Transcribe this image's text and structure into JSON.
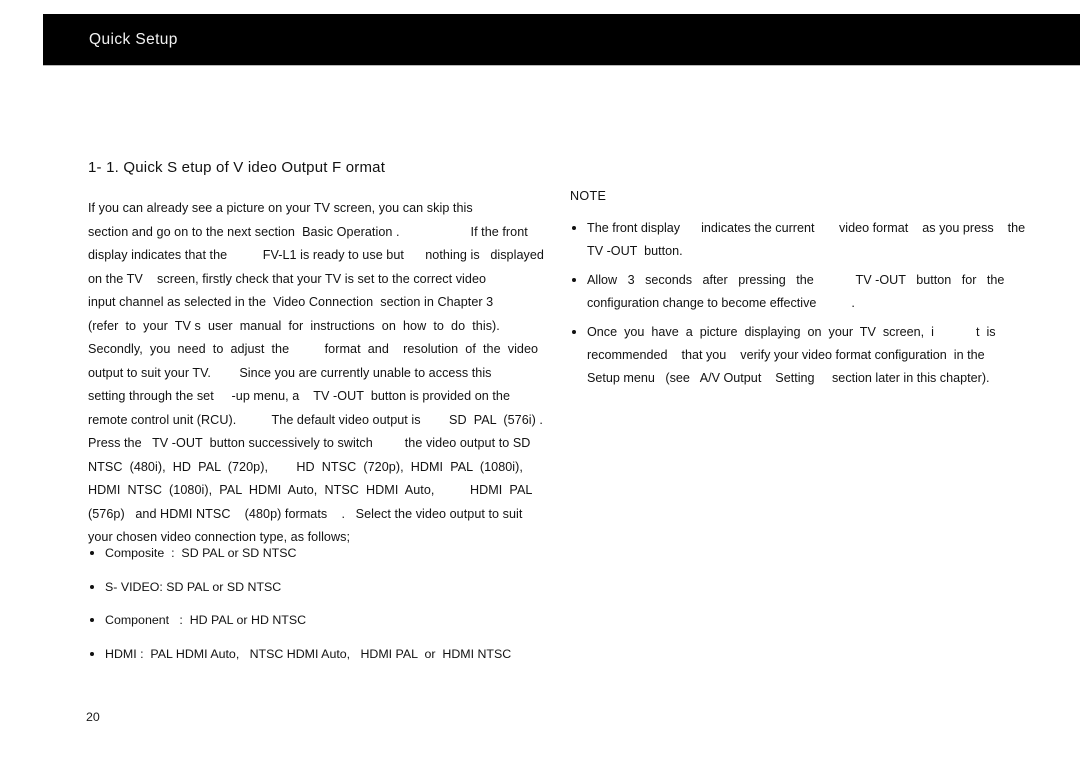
{
  "header": {
    "title": "Quick Setup"
  },
  "section": {
    "heading": "1- 1.  Quick S  etup of    V ideo  Output F    ormat"
  },
  "left_column": {
    "paragraph_lines": [
      "If you can already see a picture on your TV screen, you can skip this",
      "section and go on to the next section  Basic Operation .                    If the front",
      "display indicates that the          FV-L1 is ready to use but      nothing is   displayed",
      "on the TV    screen, firstly check that your TV is set to the correct video",
      "input channel as selected in the  Video Connection  section in Chapter 3",
      "(refer  to  your  TV s  user  manual  for  instructions  on  how  to  do  this).",
      "Secondly,  you  need  to  adjust  the          format  and    resolution  of  the  video",
      "output to suit your TV.        Since you are currently unable to access this",
      "setting through the set     -up menu, a    TV -OUT  button is provided on the",
      "remote control unit (RCU).          The default video output is        SD  PAL  (576i) .",
      "Press the   TV -OUT  button successively to switch         the video output to SD",
      "NTSC  (480i),  HD  PAL  (720p),        HD  NTSC  (720p),  HDMI  PAL  (1080i),",
      "HDMI  NTSC  (1080i),  PAL  HDMI  Auto,  NTSC  HDMI  Auto,          HDMI  PAL",
      "(576p)   and HDMI NTSC    (480p) formats    .   Select the video output to suit",
      "your chosen video connection type, as follows;"
    ],
    "bullets": [
      [
        "Composite  :  SD PAL or SD NTSC"
      ],
      [
        "S- VIDEO: SD PAL or SD NTSC"
      ],
      [
        "Component   :  HD PAL or HD NTSC"
      ],
      [
        "HDMI :  PAL HDMI Auto,   NTSC HDMI Auto,   HDMI PAL  or  HDMI NTSC"
      ]
    ]
  },
  "right_column": {
    "note_title": "NOTE",
    "note_bullets": [
      [
        "The front display      indicates the current       video format    as you press    the",
        "TV -OUT  button."
      ],
      [
        "Allow   3   seconds   after   pressing   the            TV -OUT   button   for   the",
        "configuration change to become effective          ."
      ],
      [
        "Once  you  have  a  picture  displaying  on  your  TV  screen,  i            t  is",
        "recommended    that you    verify your video format configuration  in the",
        "Setup menu   (see   A/V Output    Setting     section later in this chapter)."
      ]
    ]
  },
  "footer": {
    "page_number": "20"
  }
}
